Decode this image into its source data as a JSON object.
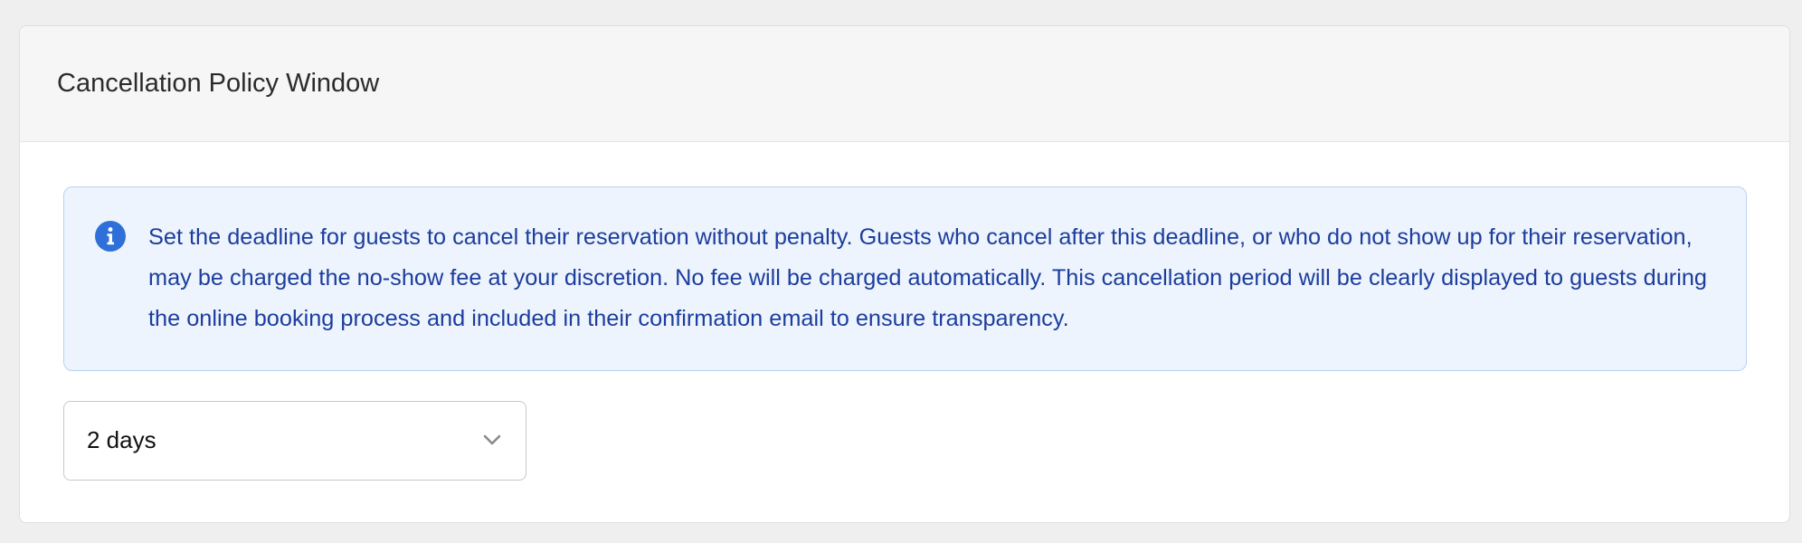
{
  "panel": {
    "title": "Cancellation Policy Window"
  },
  "notice": {
    "icon": "info-icon",
    "text": "Set the deadline for guests to cancel their reservation without penalty. Guests who cancel after this deadline, or who do not show up for their reservation, may be charged the no-show fee at your discretion. No fee will be charged automatically. This cancellation period will be clearly displayed to guests during the online booking process and included in their confirmation email to ensure transparency.",
    "accent_color": "#2f6fd8",
    "background_color": "#edf4fe",
    "text_color": "#1c3d9c"
  },
  "window_select": {
    "selected_value": "2 days",
    "icon": "chevron-down-icon"
  }
}
